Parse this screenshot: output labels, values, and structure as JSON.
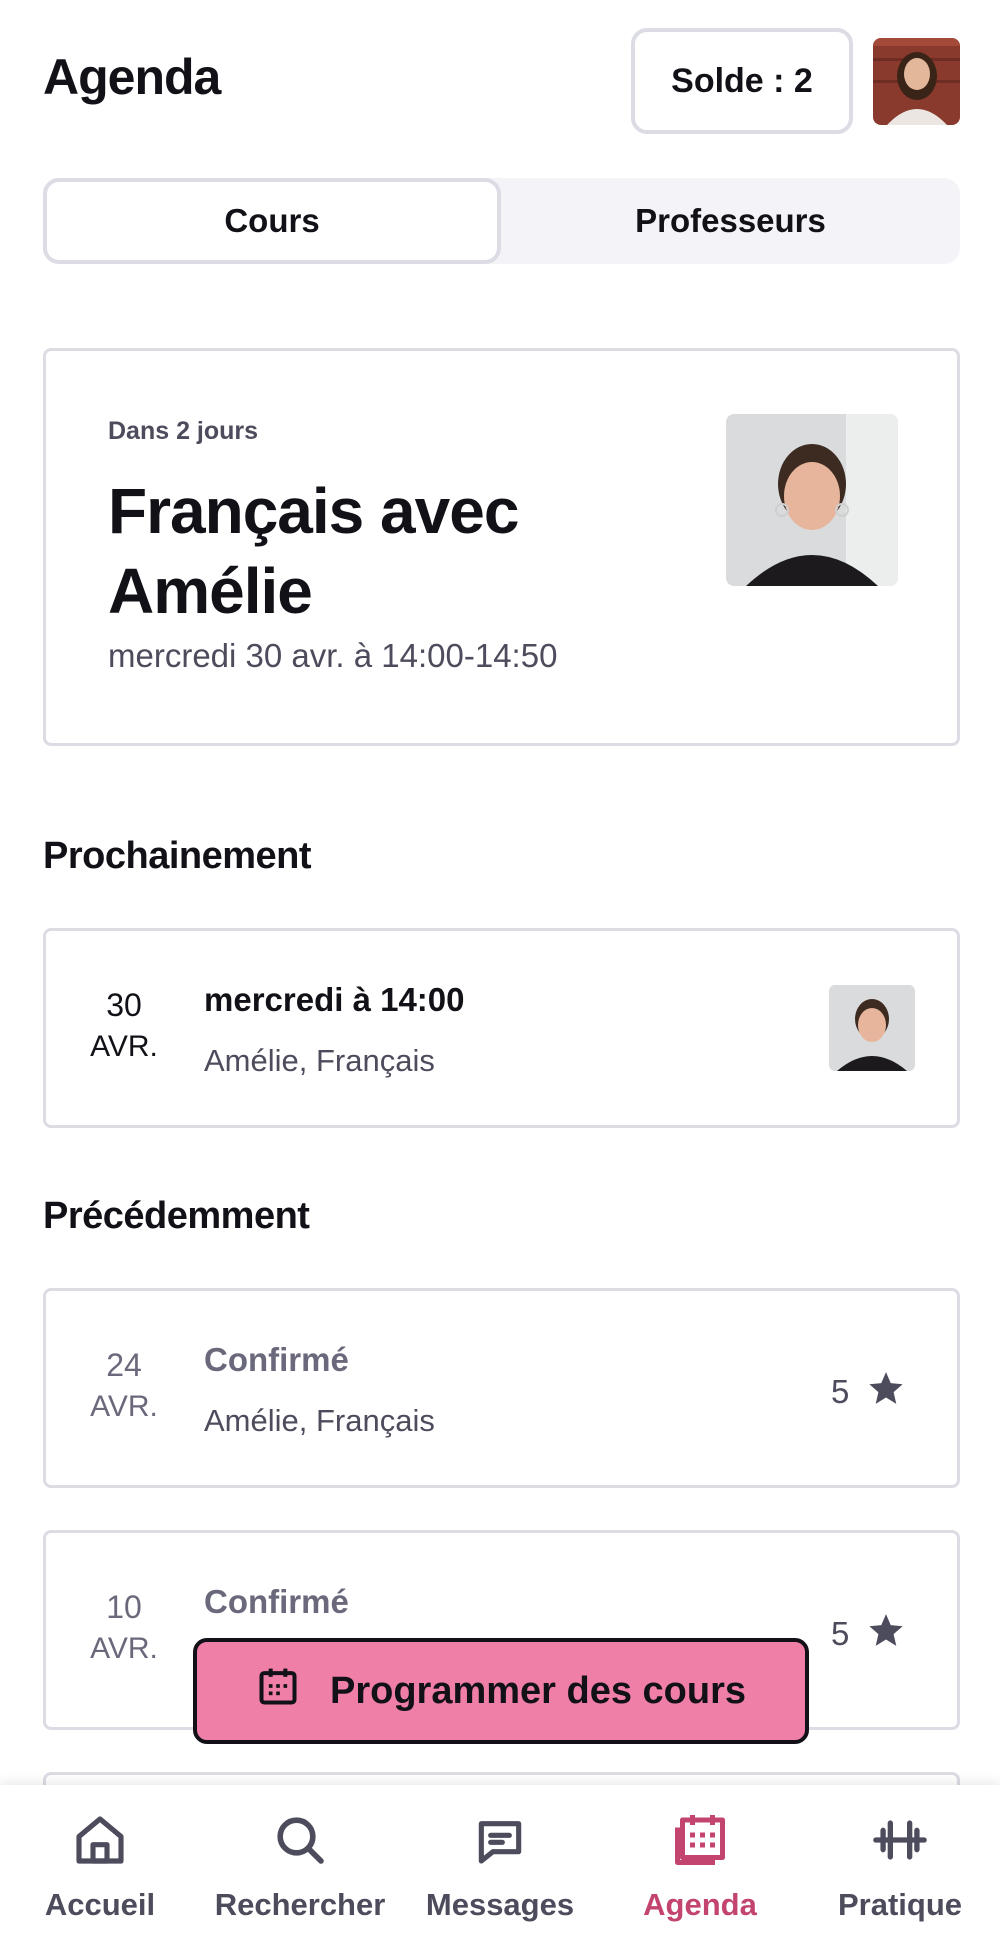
{
  "header": {
    "title": "Agenda",
    "balance_label": "Solde : 2"
  },
  "tabs": [
    {
      "label": "Cours",
      "active": true
    },
    {
      "label": "Professeurs",
      "active": false
    }
  ],
  "next_lesson": {
    "relative_time": "Dans 2 jours",
    "title": "Français avec Amélie",
    "datetime": "mercredi 30 avr. à 14:00-14:50"
  },
  "upcoming": {
    "section_title": "Prochainement",
    "items": [
      {
        "day": "30",
        "month": "AVR.",
        "main": "mercredi à 14:00",
        "sub": "Amélie, Français"
      }
    ]
  },
  "past": {
    "section_title": "Précédemment",
    "items": [
      {
        "day": "24",
        "month": "AVR.",
        "main": "Confirmé",
        "sub": "Amélie, Français",
        "rating": "5"
      },
      {
        "day": "10",
        "month": "AVR.",
        "main": "Confirmé",
        "sub": "",
        "rating": "5"
      }
    ]
  },
  "cta": {
    "label": "Programmer des cours",
    "icon": "calendar-icon"
  },
  "bottom_nav": [
    {
      "label": "Accueil",
      "icon": "home-icon",
      "active": false
    },
    {
      "label": "Rechercher",
      "icon": "search-icon",
      "active": false
    },
    {
      "label": "Messages",
      "icon": "message-icon",
      "active": false
    },
    {
      "label": "Agenda",
      "icon": "calendar-icon",
      "active": true
    },
    {
      "label": "Pratique",
      "icon": "dumbbell-icon",
      "active": false
    }
  ],
  "colors": {
    "accent": "#f07fa8",
    "active_nav": "#c2446f",
    "border": "#dcdce5",
    "text": "#121117",
    "muted": "#4d4c5c"
  }
}
